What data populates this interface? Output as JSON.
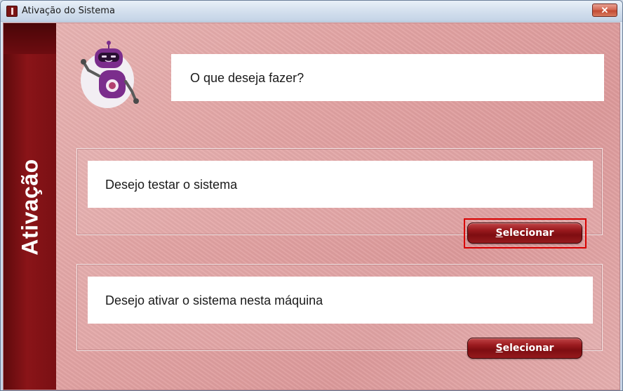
{
  "window": {
    "title": "Ativação do Sistema",
    "close_glyph": "✕"
  },
  "sidebar": {
    "label": "Ativação",
    "color": "#7a1014"
  },
  "prompt": {
    "question": "O que deseja fazer?"
  },
  "options": [
    {
      "text": "Desejo testar o sistema",
      "button_label": "Selecionar",
      "focused": true
    },
    {
      "text": "Desejo ativar o sistema nesta máquina",
      "button_label": "Selecionar",
      "focused": false
    }
  ],
  "colors": {
    "accent": "#8a1418",
    "button": "#9a1a1e",
    "focus": "#d80000",
    "robot": "#7b2d8c"
  },
  "icons": {
    "app": "app-logo-icon",
    "mascot": "robot-mascot-icon",
    "close": "close-icon"
  }
}
